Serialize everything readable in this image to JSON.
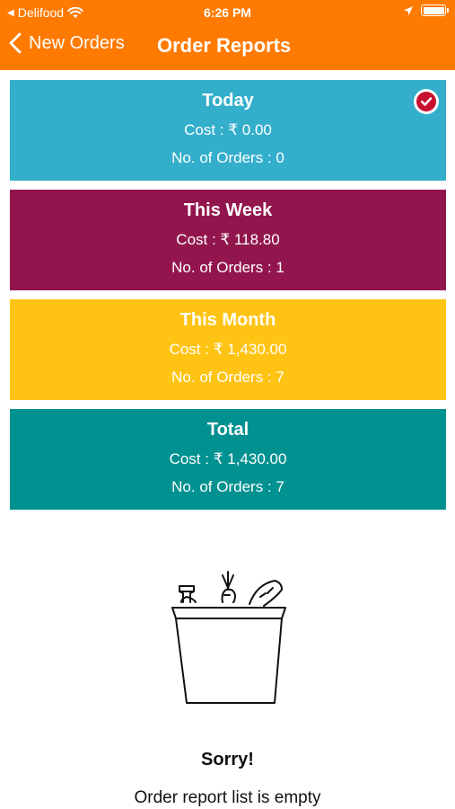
{
  "status_bar": {
    "carrier": "Delifood",
    "time": "6:26 PM"
  },
  "nav": {
    "back_label": "New Orders",
    "title": "Order Reports"
  },
  "cards": [
    {
      "title": "Today",
      "cost": "Cost : ₹ 0.00",
      "orders": "No. of Orders : 0",
      "color": "#33aecb",
      "selected": true
    },
    {
      "title": "This Week",
      "cost": "Cost : ₹ 118.80",
      "orders": "No. of Orders : 1",
      "color": "#92164d",
      "selected": false
    },
    {
      "title": "This Month",
      "cost": "Cost : ₹ 1,430.00",
      "orders": "No. of Orders : 7",
      "color": "#ffc413",
      "selected": false
    },
    {
      "title": "Total",
      "cost": "Cost : ₹ 1,430.00",
      "orders": "No. of Orders : 7",
      "color": "#009190",
      "selected": false
    }
  ],
  "empty_state": {
    "title": "Sorry!",
    "message": "Order report list is empty"
  },
  "colors": {
    "header": "#ff7a00",
    "check": "#c8102e"
  }
}
